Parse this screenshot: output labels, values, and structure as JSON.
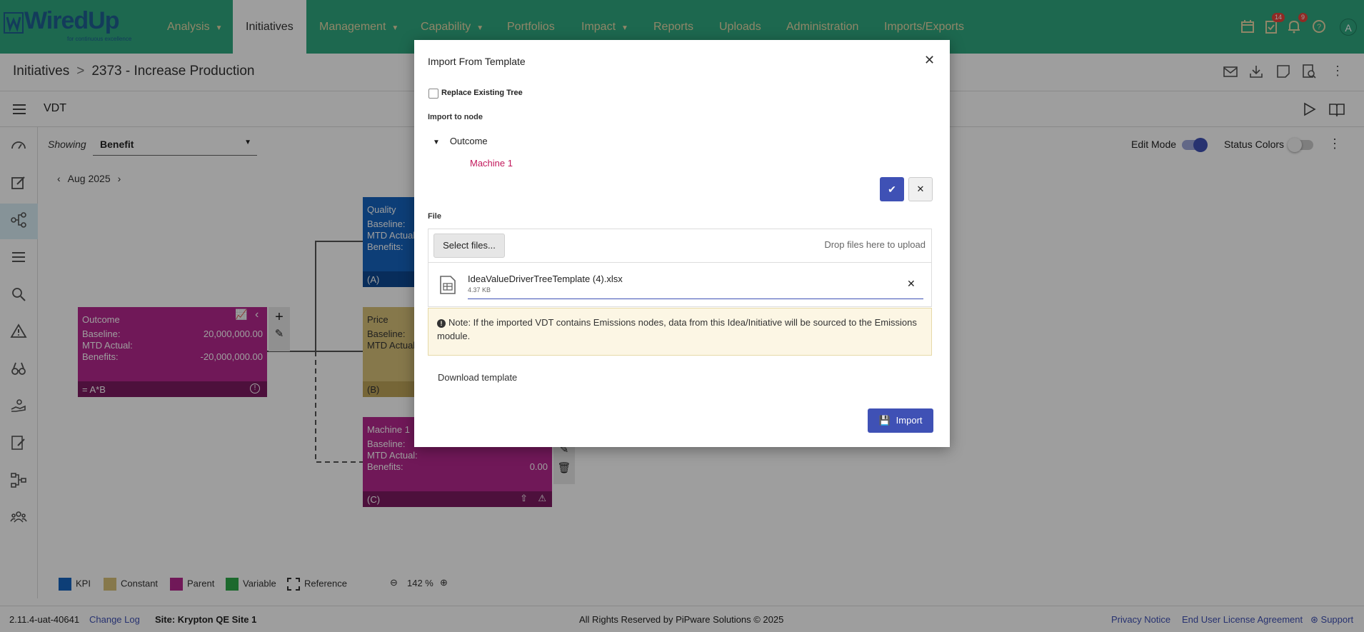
{
  "brand": {
    "name": "WiredUp",
    "tagline": "for continuous excellence"
  },
  "nav": {
    "items": [
      {
        "label": "Analysis",
        "caret": "▼"
      },
      {
        "label": "Initiatives",
        "caret": ""
      },
      {
        "label": "Management",
        "caret": "▼"
      },
      {
        "label": "Capability",
        "caret": "▼"
      },
      {
        "label": "Portfolios",
        "caret": ""
      },
      {
        "label": "Impact",
        "caret": "▼"
      },
      {
        "label": "Reports",
        "caret": ""
      },
      {
        "label": "Uploads",
        "caret": ""
      },
      {
        "label": "Administration",
        "caret": ""
      },
      {
        "label": "Imports/Exports",
        "caret": ""
      }
    ],
    "badges": {
      "tasks": "14",
      "notifications": "9"
    },
    "avatar": "A"
  },
  "breadcrumb": {
    "root": "Initiatives",
    "separator": ">",
    "current": "2373 - Increase Production"
  },
  "vdt": {
    "title": "VDT",
    "showing_label": "Showing",
    "showing_value": "Benefit",
    "month": "Aug 2025",
    "edit_mode_label": "Edit Mode",
    "status_colors_label": "Status Colors"
  },
  "nodes": {
    "outcome": {
      "title": "Outcome",
      "baseline_label": "Baseline:",
      "baseline": "20,000,000.00",
      "mtd_label": "MTD Actual:",
      "benefits_label": "Benefits:",
      "benefits": "-20,000,000.00",
      "formula": "= A*B"
    },
    "quality": {
      "title": "Quality",
      "baseline_label": "Baseline:",
      "mtd_label": "MTD Actual:",
      "benefits_label": "Benefits:",
      "tag": "(A)"
    },
    "price": {
      "title": "Price",
      "baseline_label": "Baseline:",
      "mtd_label": "MTD Actual:",
      "tag": "(B)"
    },
    "machine": {
      "title": "Machine 1",
      "baseline_label": "Baseline:",
      "mtd_label": "MTD Actual:",
      "benefits_label": "Benefits:",
      "benefits": "0.00",
      "tag": "(C)"
    }
  },
  "legend": {
    "items": [
      {
        "label": "KPI",
        "color": "#1565c0"
      },
      {
        "label": "Constant",
        "color": "#d9c27a"
      },
      {
        "label": "Parent",
        "color": "#b5278f"
      },
      {
        "label": "Variable",
        "color": "#2eaa4a"
      },
      {
        "label": "Reference",
        "color": "#ffffff"
      }
    ],
    "zoom": "142 %"
  },
  "footer": {
    "version": "2.11.4-uat-40641",
    "changelog": "Change Log",
    "site": "Site: Krypton QE Site 1",
    "copyright": "All Rights Reserved by PiPware Solutions © 2025",
    "privacy": "Privacy Notice",
    "eula": "End User License Agreement",
    "support": "Support"
  },
  "dialog": {
    "title": "Import From Template",
    "replace_label": "Replace Existing Tree",
    "import_to_node_label": "Import to node",
    "tree_root": "Outcome",
    "tree_child": "Machine 1",
    "file_label": "File",
    "select_files": "Select files...",
    "drop_hint": "Drop files here to upload",
    "file_name": "IdeaValueDriverTreeTemplate (4).xlsx",
    "file_size": "4.37 KB",
    "note": "Note: If the imported VDT contains Emissions nodes, data from this Idea/Initiative will be sourced to the Emissions module.",
    "download_template": "Download template",
    "import_button": "Import"
  },
  "colors": {
    "nav": "#2fa880",
    "primary": "#3f51b5",
    "parent": "#b5278f",
    "kpi": "#1565c0",
    "constant": "#d9c27a"
  }
}
